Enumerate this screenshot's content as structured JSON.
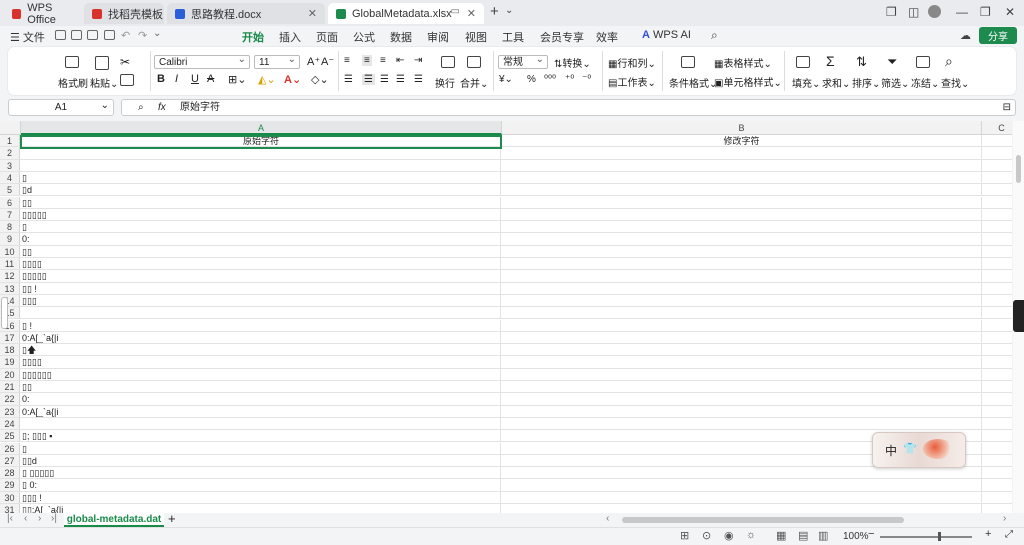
{
  "titlebar": {
    "tabs": [
      {
        "label": "WPS Office",
        "color": "#d9312b"
      },
      {
        "label": "找稻壳模板",
        "color": "#d9312b"
      },
      {
        "label": "思路教程.docx",
        "color": "#2b5fd9"
      },
      {
        "label": "GlobalMetadata.xlsx",
        "color": "#1d8a4e"
      }
    ],
    "new_tab": "+"
  },
  "menubar": {
    "file": "文件",
    "items": [
      "开始",
      "插入",
      "页面",
      "公式",
      "数据",
      "审阅",
      "视图",
      "工具",
      "会员专享",
      "效率"
    ],
    "wps_ai": "WPS AI",
    "share": "分享"
  },
  "ribbon": {
    "format_painter": "格式刷",
    "paste": "粘贴",
    "font_name": "Calibri",
    "font_size": "11",
    "wrap": "换行",
    "merge": "合并",
    "number_format": "常规",
    "convert": "转换",
    "rows_cols": "行和列",
    "worksheet": "工作表",
    "cond_format": "条件格式",
    "table_style": "表格样式",
    "cell_style": "单元格样式",
    "fill": "填充",
    "sum": "求和",
    "sort": "排序",
    "filter": "筛选",
    "freeze": "冻结",
    "find": "查找"
  },
  "formula_bar": {
    "cell_ref": "A1",
    "fx": "fx",
    "content": "原始字符"
  },
  "grid": {
    "columns": [
      "A",
      "B",
      "C"
    ],
    "rows": [
      {
        "n": "1",
        "a": "原始字符",
        "b": "修改字符"
      },
      {
        "n": "2",
        "a": "",
        "b": ""
      },
      {
        "n": "3",
        "a": "",
        "b": ""
      },
      {
        "n": "4",
        "a": "▯",
        "b": ""
      },
      {
        "n": "5",
        "a": "▯d",
        "b": ""
      },
      {
        "n": "6",
        "a": "▯▯",
        "b": ""
      },
      {
        "n": "7",
        "a": " ▯▯▯▯▯",
        "b": ""
      },
      {
        "n": "8",
        "a": "▯",
        "b": ""
      },
      {
        "n": "9",
        "a": "  0:",
        "b": ""
      },
      {
        "n": "10",
        "a": "  ▯▯",
        "b": ""
      },
      {
        "n": "11",
        "a": "  ▯▯▯▯",
        "b": ""
      },
      {
        "n": "12",
        "a": "  ▯▯▯▯▯",
        "b": ""
      },
      {
        "n": "13",
        "a": "▯▯ !",
        "b": ""
      },
      {
        "n": "14",
        "a": "▯▯▯",
        "b": ""
      },
      {
        "n": "15",
        "a": "",
        "b": ""
      },
      {
        "n": "16",
        "a": "▯ !",
        "b": ""
      },
      {
        "n": "17",
        "a": "0:A[_`a{|i",
        "b": ""
      },
      {
        "n": "18",
        "a": "▯🡅",
        "b": ""
      },
      {
        "n": "19",
        "a": "▯▯▯▯",
        "b": ""
      },
      {
        "n": "20",
        "a": "▯▯▯▯▯▯",
        "b": ""
      },
      {
        "n": "21",
        "a": "▯▯",
        "b": ""
      },
      {
        "n": "22",
        "a": "0:",
        "b": ""
      },
      {
        "n": "23",
        "a": "0:A[_`a{|i",
        "b": ""
      },
      {
        "n": "24",
        "a": "",
        "b": ""
      },
      {
        "n": "25",
        "a": "▯; ▯▯▯              ▪",
        "b": ""
      },
      {
        "n": "26",
        "a": "▯",
        "b": ""
      },
      {
        "n": "27",
        "a": "▯▯d",
        "b": ""
      },
      {
        "n": "28",
        "a": "▯ ▯▯▯▯▯",
        "b": ""
      },
      {
        "n": "29",
        "a": "▯ 0:",
        "b": ""
      },
      {
        "n": "30",
        "a": "▯▯▯ !",
        "b": ""
      },
      {
        "n": "31",
        "a": "▯▯:A[_`a{|i",
        "b": ""
      }
    ]
  },
  "sheet_tabs": {
    "active": "global-metadata.dat",
    "add": "+"
  },
  "statusbar": {
    "zoom": "100%"
  },
  "ime": {
    "mode": "中"
  }
}
